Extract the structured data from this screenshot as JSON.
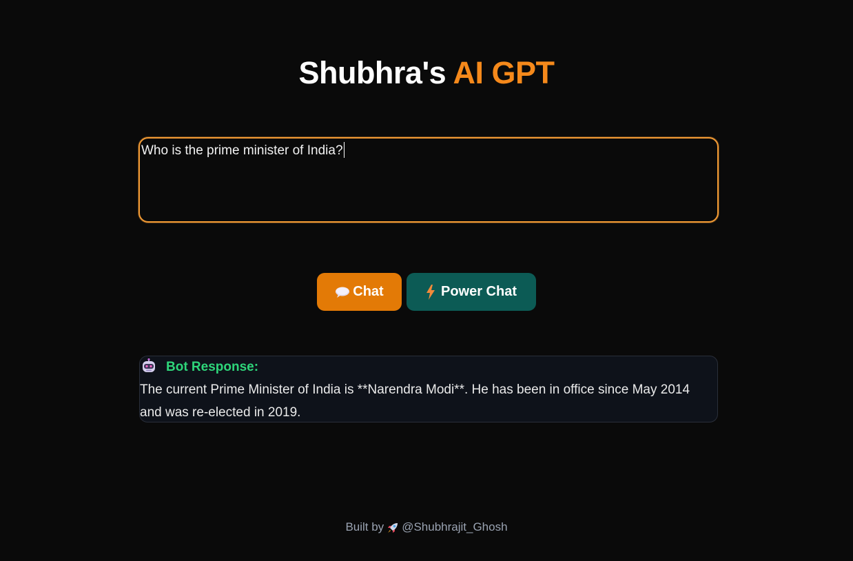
{
  "header": {
    "title_main": "Shubhra's",
    "title_accent": "AI GPT",
    "accent_color": "#f5891b"
  },
  "prompt": {
    "value": "Who is the prime minister of India?",
    "border_color": "#f29a34"
  },
  "actions": {
    "chat_label": "Chat",
    "chat_icon": "speech-bubble-icon",
    "chat_color": "#e37a06",
    "power_chat_label": "Power Chat",
    "power_chat_icon": "lightning-icon",
    "power_chat_color": "#0c5b55"
  },
  "response": {
    "label": "Bot Response:",
    "label_color": "#2ed67a",
    "icon": "robot-icon",
    "text": "The current Prime Minister of India is **Narendra Modi**. He has been in office since May 2014 and was re-elected in 2019."
  },
  "footer": {
    "prefix": "Built by",
    "icon": "rocket-icon",
    "handle": "@Shubhrajit_Ghosh"
  }
}
